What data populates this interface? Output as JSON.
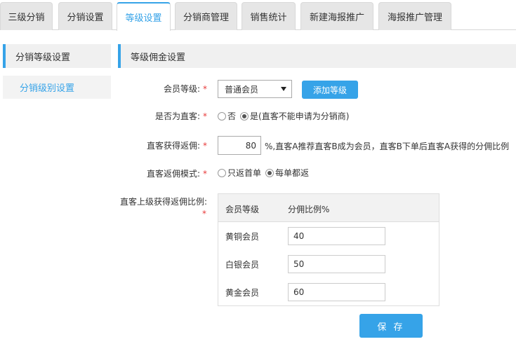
{
  "tabs": [
    {
      "label": "三级分销"
    },
    {
      "label": "分销设置"
    },
    {
      "label": "等级设置"
    },
    {
      "label": "分销商管理"
    },
    {
      "label": "销售统计"
    },
    {
      "label": "新建海报推广"
    },
    {
      "label": "海报推广管理"
    }
  ],
  "sidebar": {
    "header": "分销等级设置",
    "items": [
      {
        "label": "分销级别设置"
      }
    ]
  },
  "panel": {
    "title": "等级佣金设置"
  },
  "form": {
    "required_mark": "*",
    "member_level": {
      "label": "会员等级:",
      "selected": "普通会员",
      "add_button": "添加等级"
    },
    "is_direct": {
      "label": "是否为直客:",
      "option_no": "否",
      "option_yes": "是(直客不能申请为分销商)",
      "selected": "yes"
    },
    "direct_rebate": {
      "label": "直客获得返佣:",
      "value": "80",
      "note": "%,直客A推荐直客B成为会员，直客B下单后直客A获得的分佣比例"
    },
    "rebate_mode": {
      "label": "直客返佣模式:",
      "option_first": "只返首单",
      "option_every": "每单都返",
      "selected": "every"
    },
    "upper_rebate": {
      "label": "直客上级获得返佣比例:",
      "columns": [
        "会员等级",
        "分佣比例%"
      ],
      "rows": [
        {
          "level": "黄铜会员",
          "value": "40"
        },
        {
          "level": "白银会员",
          "value": "50"
        },
        {
          "level": "黄金会员",
          "value": "60"
        }
      ]
    },
    "save_button": "保 存"
  },
  "colors": {
    "accent": "#36a3e8",
    "required": "#e83a3a"
  }
}
